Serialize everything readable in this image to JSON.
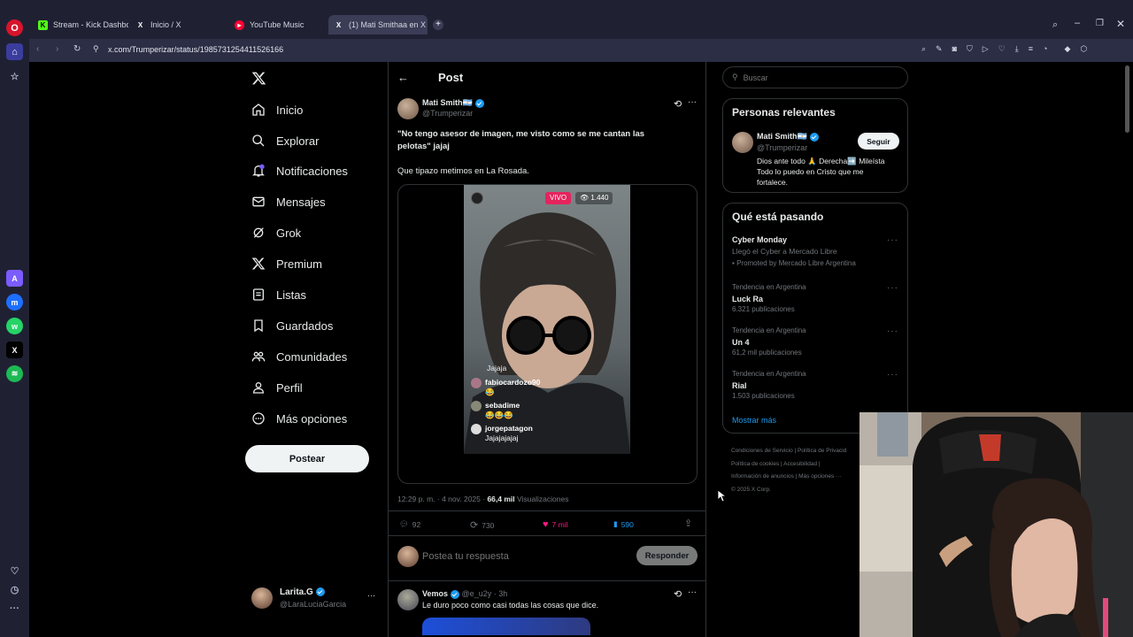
{
  "browser": {
    "tabs": [
      {
        "label": "Stream - Kick Dashboard",
        "favicon": "kick-icon"
      },
      {
        "label": "Inicio / X",
        "favicon": "x-icon"
      },
      {
        "label": "YouTube Music",
        "favicon": "youtube-music-icon"
      },
      {
        "label": "(1) Mati Smithaa en X",
        "favicon": "x-icon",
        "active": true
      }
    ],
    "url": "x.com/Trumperizar/status/1985731254411526166"
  },
  "nav": {
    "logo": "X",
    "items": [
      {
        "label": "Inicio",
        "icon": "home-icon"
      },
      {
        "label": "Explorar",
        "icon": "search-icon"
      },
      {
        "label": "Notificaciones",
        "icon": "bell-icon"
      },
      {
        "label": "Mensajes",
        "icon": "mail-icon"
      },
      {
        "label": "Grok",
        "icon": "grok-icon"
      },
      {
        "label": "Premium",
        "icon": "x-premium-icon"
      },
      {
        "label": "Listas",
        "icon": "list-icon"
      },
      {
        "label": "Guardados",
        "icon": "bookmark-icon"
      },
      {
        "label": "Comunidades",
        "icon": "people-icon"
      },
      {
        "label": "Perfil",
        "icon": "person-icon"
      },
      {
        "label": "Más opciones",
        "icon": "more-circle-icon"
      }
    ],
    "post_button": "Postear",
    "account": {
      "name": "Larita.G",
      "handle": "@LaraLuciaGarcia"
    }
  },
  "post": {
    "header": "Post",
    "author_name": "Mati Smith🇦🇷",
    "author_handle": "@Trumperizar",
    "text_line1": "\"No tengo asesor de imagen, me visto como se me cantan las",
    "text_line2": "pelotas\" jajaj",
    "text_para2": "Que tipazo metimos en La Rosada.",
    "video": {
      "live_badge": "VIVO",
      "viewers": "1.440",
      "comment_intro": "Jajaja",
      "comments": [
        {
          "user": "fabiocardozo90",
          "text": "😂"
        },
        {
          "user": "sebadime",
          "text": "😂😂😂"
        },
        {
          "user": "jorgepatagon",
          "text": "Jajajajajaj"
        }
      ]
    },
    "timestamp": "12:29 p. m. · 4 nov. 2025 ·",
    "views_count": "66,4 mil",
    "views_label": "Visualizaciones",
    "stats": {
      "replies": "92",
      "reposts": "730",
      "likes": "7 mil",
      "bookmarks": "590"
    },
    "reply_placeholder": "Postea tu respuesta",
    "reply_button": "Responder"
  },
  "reply": {
    "name": "Vemos",
    "handle": "@e_u2y",
    "time": "· 3h",
    "text": "Le duro poco como casi todas las cosas que dice."
  },
  "search": {
    "placeholder": "Buscar"
  },
  "relevant": {
    "title": "Personas relevantes",
    "name": "Mati Smith🇦🇷",
    "handle": "@Trumperizar",
    "follow": "Seguir",
    "bio_line1": "Dios ante todo 🙏 Derecha➡️ Mileísta",
    "bio_line2": "Todo lo puedo en Cristo que me",
    "bio_line3": "fortalece."
  },
  "trends": {
    "title": "Qué está pasando",
    "promo": {
      "name": "Cyber Monday",
      "desc": "Llegó el Cyber a Mercado Libre",
      "promoted": "Promoted by Mercado Libre Argentina"
    },
    "items": [
      {
        "context": "Tendencia en Argentina",
        "name": "Luck Ra",
        "count": "6.321 publicaciones"
      },
      {
        "context": "Tendencia en Argentina",
        "name": "Un 4",
        "count": "61,2 mil publicaciones"
      },
      {
        "context": "Tendencia en Argentina",
        "name": "Rial",
        "count": "1.503 publicaciones"
      }
    ],
    "show_more": "Mostrar más"
  },
  "footer": {
    "l1a": "Condiciones de Servicio",
    "l1b": "Política de Privacid",
    "l2a": "Política de cookies",
    "l2b": "Accesibilidad",
    "l3a": "Información de anuncios",
    "l3b": "Más opciones ···",
    "copyright": "© 2025 X Corp."
  },
  "colors": {
    "accent": "#1d9bf0",
    "like": "#f91880",
    "bg": "#000000",
    "browser": "#1f2133"
  }
}
